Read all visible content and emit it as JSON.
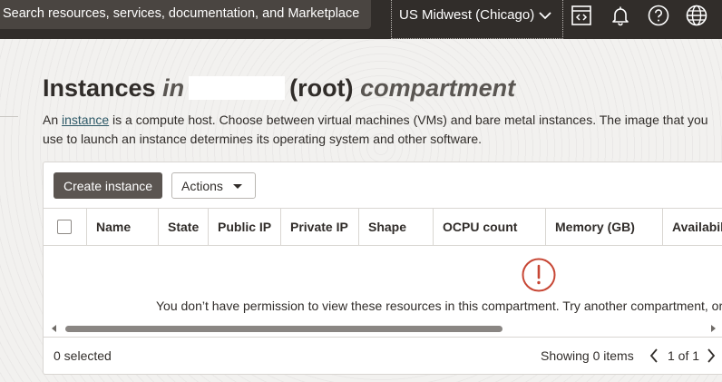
{
  "header": {
    "search_placeholder": "Search resources, services, documentation, and Marketplace",
    "region": "US Midwest (Chicago)",
    "icons": [
      "code-editor-icon",
      "bell-icon",
      "help-icon",
      "globe-icon"
    ]
  },
  "page": {
    "title_prefix": "Instances",
    "title_in": "in",
    "title_root": "(root)",
    "title_suffix": "compartment",
    "intro_pre": "An ",
    "intro_link": "instance",
    "intro_post": " is a compute host. Choose between virtual machines (VMs) and bare metal instances. The image that you use to launch an instance determines its operating system and other software."
  },
  "toolbar": {
    "create_label": "Create instance",
    "actions_label": "Actions"
  },
  "table": {
    "columns": [
      "Name",
      "State",
      "Public IP",
      "Private IP",
      "Shape",
      "OCPU count",
      "Memory (GB)",
      "Availabil"
    ],
    "empty_message": "You don’t have permission to view these resources in this compartment. Try another compartment, or"
  },
  "footer": {
    "selected": "0 selected",
    "showing": "Showing 0 items",
    "page": "1 of 1"
  },
  "colors": {
    "topbar": "#312d2a",
    "primary_button": "#5b5551",
    "warning": "#c74634",
    "link": "#2d5967"
  }
}
